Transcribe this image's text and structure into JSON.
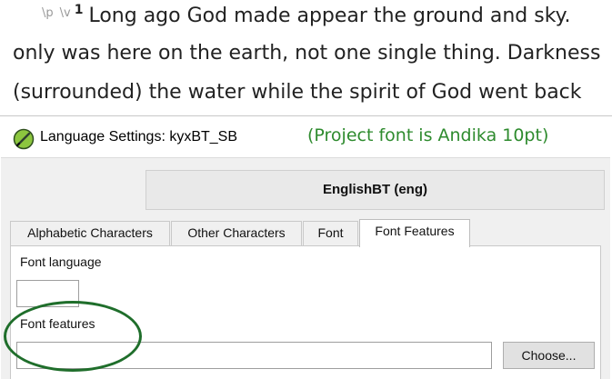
{
  "scripture": {
    "para_marker": "\\p",
    "verse_marker": "\\v",
    "verse_number": "1",
    "line1": "Long ago God made appear the ground and sky.",
    "line2": "only was here on the earth, not one single thing. Darkness",
    "line3": "(surrounded) the water while the spirit of God went back"
  },
  "dialog": {
    "title": "Language Settings: kyxBT_SB",
    "note": "(Project font is Andika 10pt)",
    "writing_system": "EnglishBT (eng)",
    "tabs": [
      {
        "label": "Alphabetic Characters",
        "active": false
      },
      {
        "label": "Other Characters",
        "active": false
      },
      {
        "label": "Font",
        "active": false
      },
      {
        "label": "Font Features",
        "active": true
      }
    ],
    "font_language_label": "Font language",
    "font_language_value": "",
    "font_features_label": "Font features",
    "font_features_value": "",
    "choose_button": "Choose..."
  },
  "colors": {
    "note_text": "#2e8b2e",
    "highlight_ellipse": "#1f6e2b",
    "icon_fill": "#8cc63f"
  },
  "icons": {
    "app_icon": "pencil-leaf-icon"
  }
}
